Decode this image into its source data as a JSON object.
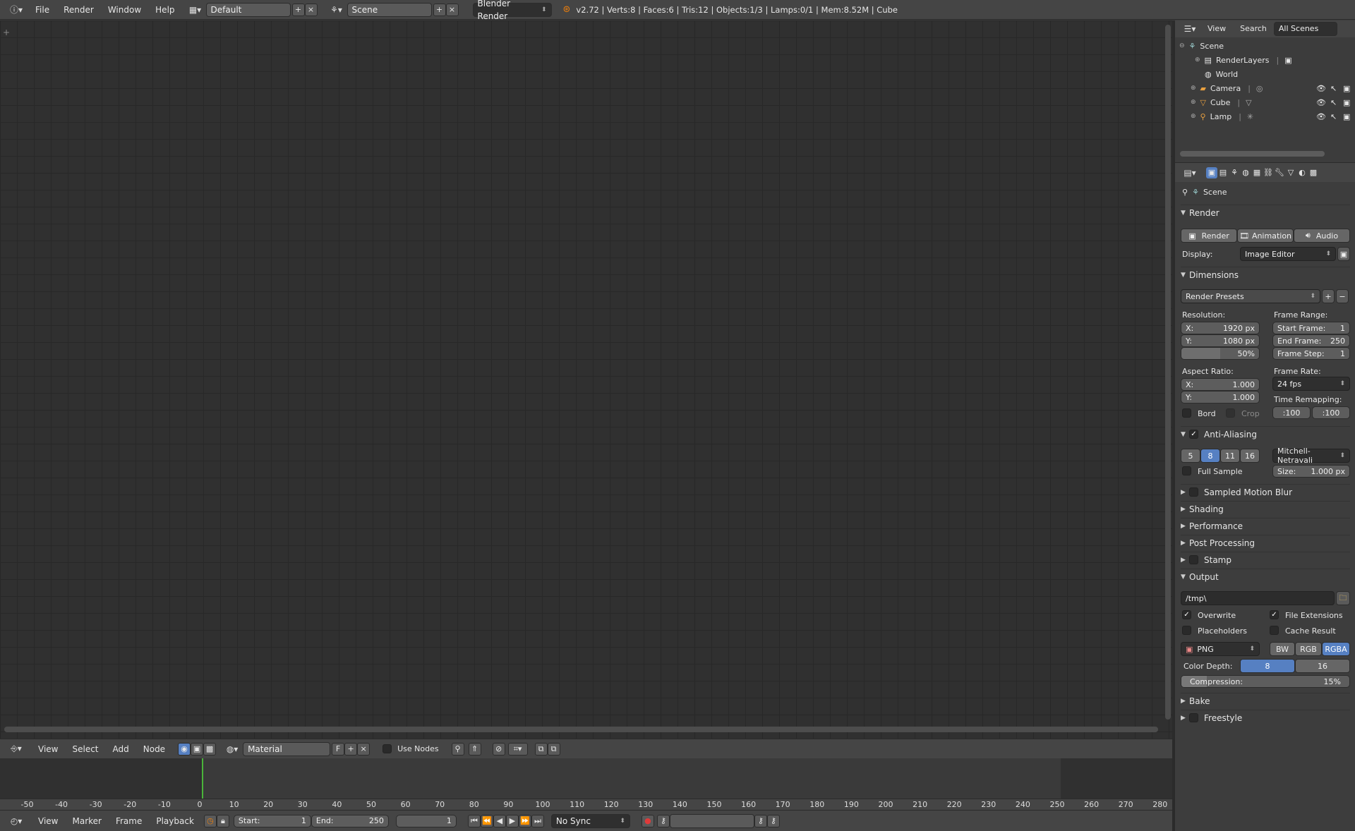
{
  "info_header": {
    "menus": [
      "File",
      "Render",
      "Window",
      "Help"
    ],
    "screen_layout": "Default",
    "scene": "Scene",
    "render_engine": "Blender Render",
    "stats": "v2.72 | Verts:8 | Faces:6 | Tris:12 | Objects:1/3 | Lamps:0/1 | Mem:8.52M | Cube"
  },
  "outliner": {
    "header": {
      "view": "View",
      "search": "Search",
      "filter": "All Scenes"
    },
    "items": [
      {
        "label": "Scene",
        "icon": "scene-icon"
      },
      {
        "label": "RenderLayers",
        "icon": "renderlayers-icon"
      },
      {
        "label": "World",
        "icon": "world-icon"
      },
      {
        "label": "Camera",
        "icon": "camera-icon"
      },
      {
        "label": "Cube",
        "icon": "mesh-icon"
      },
      {
        "label": "Lamp",
        "icon": "lamp-icon"
      }
    ]
  },
  "properties": {
    "context": "Scene",
    "render_panel": {
      "title": "Render",
      "buttons": [
        "Render",
        "Animation",
        "Audio"
      ],
      "display_label": "Display:",
      "display_value": "Image Editor"
    },
    "dimensions": {
      "title": "Dimensions",
      "presets": "Render Presets",
      "resolution_label": "Resolution:",
      "res_x_label": "X:",
      "res_x": "1920 px",
      "res_y_label": "Y:",
      "res_y": "1080 px",
      "res_percent": "50%",
      "frame_range_label": "Frame Range:",
      "start_label": "Start Frame:",
      "start": "1",
      "end_label": "End Frame:",
      "end": "250",
      "step_label": "Frame Step:",
      "step": "1",
      "aspect_label": "Aspect Ratio:",
      "aspect_x_label": "X:",
      "aspect_x": "1.000",
      "aspect_y_label": "Y:",
      "aspect_y": "1.000",
      "frame_rate_label": "Frame Rate:",
      "frame_rate": "24 fps",
      "time_remap_label": "Time Remapping:",
      "remap_old": ":100",
      "remap_new": ":100",
      "bord": "Bord",
      "crop": "Crop"
    },
    "anti_aliasing": {
      "title": "Anti-Aliasing",
      "samples": [
        "5",
        "8",
        "11",
        "16"
      ],
      "active_sample": "8",
      "filter": "Mitchell-Netravali",
      "full_sample": "Full Sample",
      "size_label": "Size:",
      "size": "1.000 px"
    },
    "collapsed_panels": [
      "Sampled Motion Blur",
      "Shading",
      "Performance",
      "Post Processing",
      "Stamp"
    ],
    "output": {
      "title": "Output",
      "path": "/tmp\\",
      "overwrite": "Overwrite",
      "file_extensions": "File Extensions",
      "placeholders": "Placeholders",
      "cache_result": "Cache Result",
      "format": "PNG",
      "color_modes": [
        "BW",
        "RGB",
        "RGBA"
      ],
      "active_color_mode": "RGBA",
      "color_depth_label": "Color Depth:",
      "depths": [
        "8",
        "16"
      ],
      "compression_label": "Compression:",
      "compression": "15%",
      "compression_fraction": 0.15
    },
    "bottom_panels": [
      "Bake",
      "Freestyle"
    ]
  },
  "node_header": {
    "menus": [
      "View",
      "Select",
      "Add",
      "Node"
    ],
    "material": "Material",
    "fake_user": "F",
    "use_nodes": "Use Nodes"
  },
  "timeline": {
    "ticks": [
      "-50",
      "-40",
      "-30",
      "-20",
      "-10",
      "0",
      "10",
      "20",
      "30",
      "40",
      "50",
      "60",
      "70",
      "80",
      "90",
      "100",
      "110",
      "120",
      "130",
      "140",
      "150",
      "160",
      "170",
      "180",
      "190",
      "200",
      "210",
      "220",
      "230",
      "240",
      "250",
      "260",
      "270",
      "280"
    ],
    "current_frame": "1",
    "header": {
      "menus": [
        "View",
        "Marker",
        "Frame",
        "Playback"
      ],
      "start_label": "Start:",
      "start": "1",
      "end_label": "End:",
      "end": "250",
      "frame": "1",
      "sync": "No Sync"
    }
  },
  "colors": {
    "accent": "#5680c2",
    "playhead": "#4ab43a",
    "background": "#303030"
  }
}
